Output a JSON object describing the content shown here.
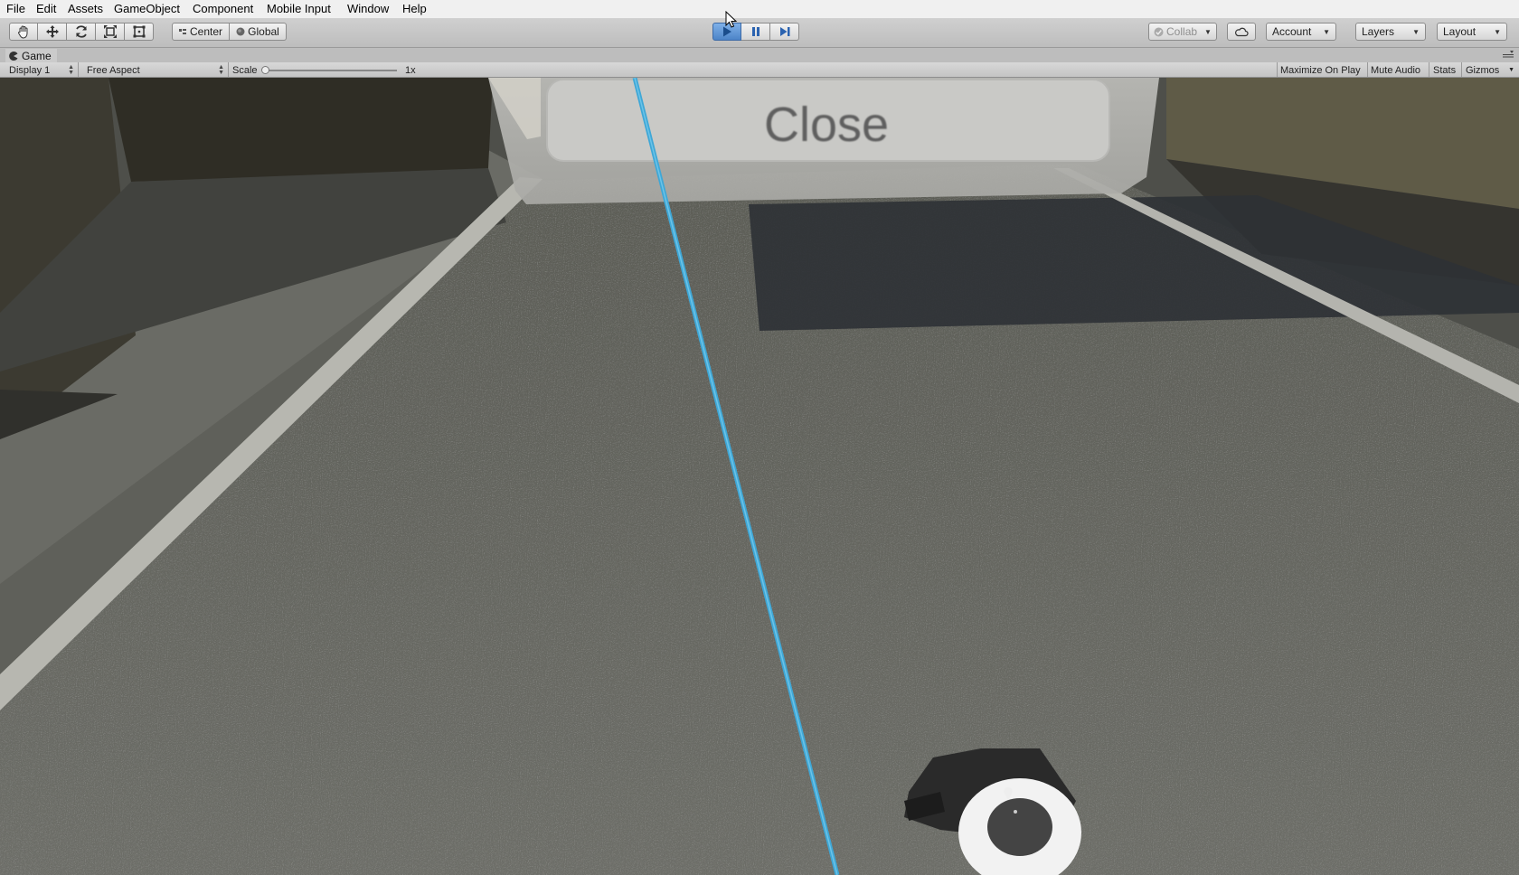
{
  "menu": [
    "File",
    "Edit",
    "Assets",
    "GameObject",
    "Component",
    "Mobile Input",
    "Window",
    "Help"
  ],
  "toolbar": {
    "pivot_label": "Center",
    "space_label": "Global",
    "collab_label": "Collab",
    "account_label": "Account",
    "layers_label": "Layers",
    "layout_label": "Layout",
    "play_state": "playing",
    "accent_color": "#4c84c8"
  },
  "game_view": {
    "tab_label": "Game",
    "display_label": "Display 1",
    "aspect_label": "Free Aspect",
    "scale_label": "Scale",
    "scale_value": "1x",
    "maximize_label": "Maximize On Play",
    "mute_label": "Mute Audio",
    "stats_label": "Stats",
    "gizmos_label": "Gizmos"
  },
  "scene": {
    "button_text": "Close",
    "laser_color": "#3fa7d6"
  }
}
